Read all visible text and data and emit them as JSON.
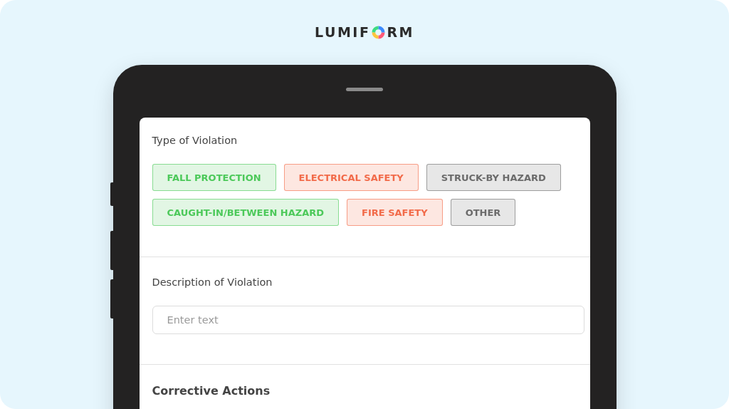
{
  "logo": {
    "before": "LUMIF",
    "after": "RM"
  },
  "violation_type": {
    "label": "Type of Violation",
    "chips": [
      {
        "label": "FALL PROTECTION",
        "color": "#4cc95a"
      },
      {
        "label": "ELECTRICAL SAFETY",
        "color": "#f26b4a"
      },
      {
        "label": "STRUCK-BY HAZARD",
        "color": "#6b6b6b"
      },
      {
        "label": "CAUGHT-IN/BETWEEN HAZARD",
        "color": "#4cc95a"
      },
      {
        "label": "FIRE SAFETY",
        "color": "#f26b4a"
      },
      {
        "label": "OTHER",
        "color": "#6b6b6b"
      }
    ]
  },
  "description": {
    "label": "Description of Violation",
    "placeholder": "Enter text"
  },
  "corrective_actions": {
    "label": "Corrective Actions"
  }
}
